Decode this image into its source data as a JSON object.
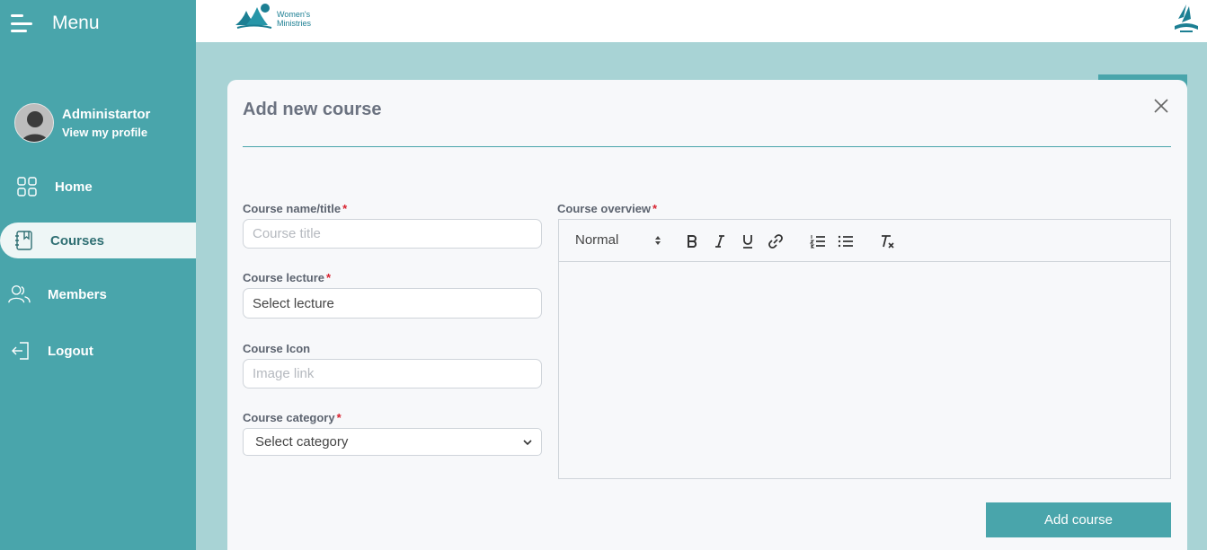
{
  "sidebar": {
    "menu_label": "Menu",
    "profile": {
      "name": "Administartor",
      "link": "View my profile"
    },
    "items": [
      {
        "label": "Home",
        "icon": "grid-icon",
        "active": false
      },
      {
        "label": "Courses",
        "icon": "book-icon",
        "active": true
      },
      {
        "label": "Members",
        "icon": "users-icon",
        "active": false
      },
      {
        "label": "Logout",
        "icon": "logout-icon",
        "active": false
      }
    ]
  },
  "topbar": {
    "brand_line1": "Women's",
    "brand_line2": "Ministries"
  },
  "modal": {
    "title": "Add new course",
    "fields": {
      "course_name": {
        "label": "Course name/title",
        "placeholder": "Course title",
        "required": "*"
      },
      "course_lecture": {
        "label": "Course lecture",
        "value": "Select lecture",
        "required": "*"
      },
      "course_icon": {
        "label": "Course Icon",
        "placeholder": "Image link"
      },
      "course_category": {
        "label": "Course category",
        "value": "Select category",
        "required": "*"
      },
      "course_overview": {
        "label": "Course overview",
        "required": "*"
      }
    },
    "editor": {
      "format": "Normal"
    },
    "submit_label": "Add course"
  },
  "colors": {
    "accent": "#49a5ab",
    "background": "#a8d3d5",
    "required": "#d8222f"
  }
}
